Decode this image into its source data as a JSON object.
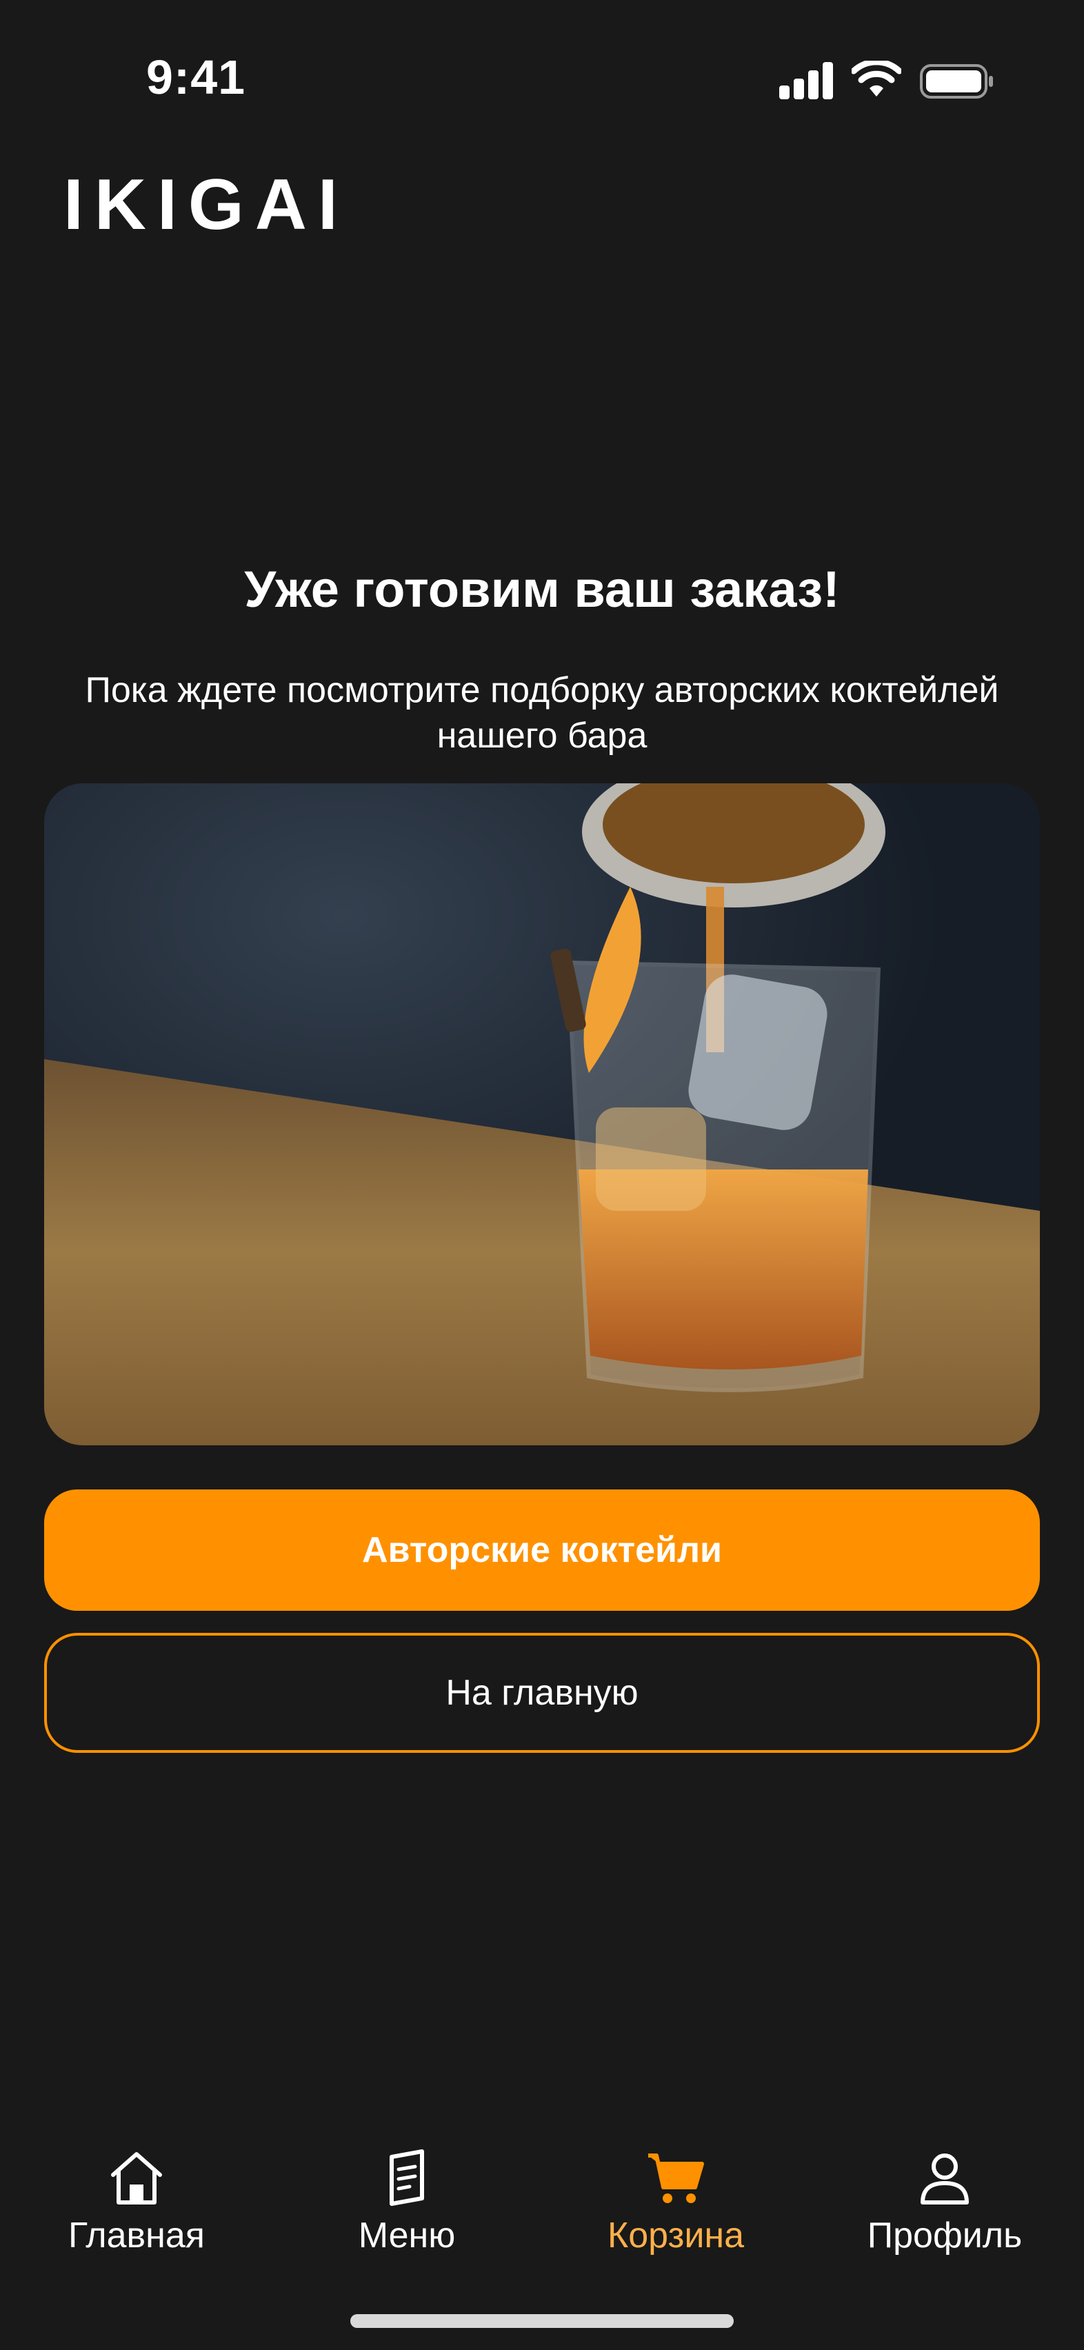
{
  "status_bar": {
    "time": "9:41"
  },
  "header": {
    "logo": "IKIGAI"
  },
  "main": {
    "title": "Уже готовим ваш заказ!",
    "subtitle_line1": "Пока ждете посмотрите подборку авторских коктейлей",
    "subtitle_line2": "нашего бара",
    "image_icon": "cocktail-photo",
    "primary_button": "Авторские коктейли",
    "secondary_button": "На главную"
  },
  "tabbar": {
    "items": [
      {
        "label": "Главная",
        "icon": "home-icon",
        "active": false
      },
      {
        "label": "Меню",
        "icon": "menu-book-icon",
        "active": false
      },
      {
        "label": "Корзина",
        "icon": "cart-icon",
        "active": true
      },
      {
        "label": "Профиль",
        "icon": "profile-icon",
        "active": false
      }
    ]
  },
  "colors": {
    "background": "#191919",
    "accent": "#ff9100",
    "active_tab": "#ffb04a",
    "text": "#ffffff"
  }
}
